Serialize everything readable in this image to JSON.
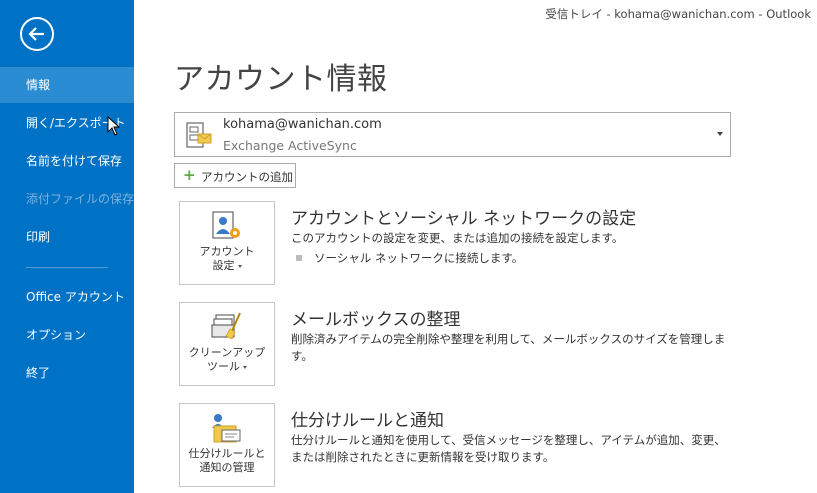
{
  "window": {
    "title": "受信トレイ - kohama@wanichan.com - Outlook"
  },
  "sidebar": {
    "items": [
      {
        "label": "情報",
        "state": "active"
      },
      {
        "label": "開く/エクスポート",
        "state": "hover"
      },
      {
        "label": "名前を付けて保存",
        "state": "normal"
      },
      {
        "label": "添付ファイルの保存",
        "state": "disabled"
      },
      {
        "label": "印刷",
        "state": "normal"
      },
      {
        "label": "Office アカウント",
        "state": "normal"
      },
      {
        "label": "オプション",
        "state": "normal"
      },
      {
        "label": "終了",
        "state": "normal"
      }
    ],
    "bg_color": "#0072C6",
    "active_color": "#2A8DD4"
  },
  "main": {
    "title": "アカウント情報",
    "account": {
      "email": "kohama@wanichan.com",
      "type": "Exchange ActiveSync"
    },
    "add_account_label": "アカウントの追加",
    "sections": [
      {
        "tile_lines": [
          "アカウント",
          "設定"
        ],
        "title": "アカウントとソーシャル ネットワークの設定",
        "description": "このアカウントの設定を変更、または追加の接続を設定します。",
        "bullet": "ソーシャル ネットワークに接続します。",
        "icon": "account-settings-icon"
      },
      {
        "tile_lines": [
          "クリーンアップ",
          "ツール"
        ],
        "title": "メールボックスの整理",
        "description": "削除済みアイテムの完全削除や整理を利用して、メールボックスのサイズを管理します。",
        "icon": "cleanup-tools-icon"
      },
      {
        "tile_lines": [
          "仕分けルールと",
          "通知の管理"
        ],
        "title": "仕分けルールと通知",
        "description": "仕分けルールと通知を使用して、受信メッセージを整理し、アイテムが追加、変更、または削除されたときに更新情報を受け取ります。",
        "icon": "rules-alerts-icon"
      }
    ]
  }
}
